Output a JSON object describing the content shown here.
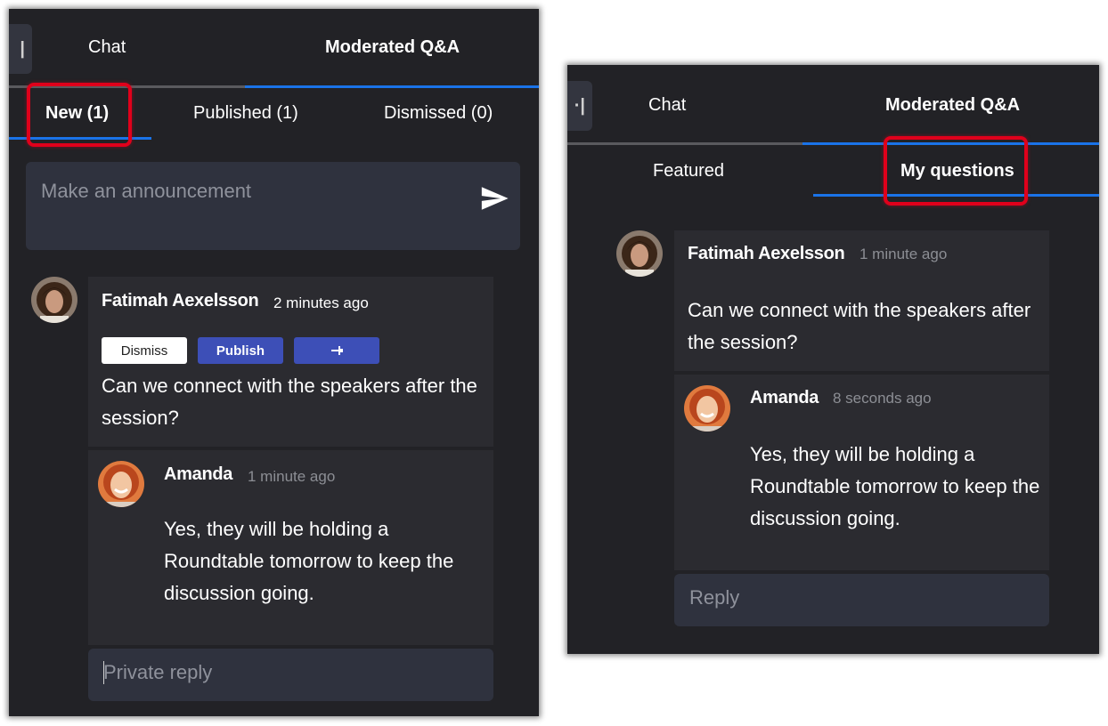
{
  "left": {
    "tabs": {
      "chat": "Chat",
      "qa": "Moderated Q&A"
    },
    "subtabs": {
      "new": "New (1)",
      "published": "Published (1)",
      "dismissed": "Dismissed (0)"
    },
    "announcement": {
      "placeholder": "Make an announcement"
    },
    "question": {
      "author": "Fatimah Aexelsson",
      "time": "2 minutes ago",
      "buttons": {
        "dismiss": "Dismiss",
        "publish": "Publish"
      },
      "text": "Can we connect with the speakers after the session?"
    },
    "reply": {
      "author": "Amanda",
      "time": "1 minute ago",
      "text": "Yes, they will be holding a Roundtable tomorrow to keep the discussion going."
    },
    "private_reply": {
      "placeholder": "Private reply"
    }
  },
  "right": {
    "tabs": {
      "chat": "Chat",
      "qa": "Moderated Q&A"
    },
    "subtabs": {
      "featured": "Featured",
      "my_questions": "My questions"
    },
    "question": {
      "author": "Fatimah Aexelsson",
      "time": "1 minute ago",
      "text": "Can we connect with the speakers after the session?"
    },
    "reply": {
      "author": "Amanda",
      "time": "8 seconds ago",
      "text": "Yes, they will be holding a Roundtable tomorrow to keep the discussion going."
    },
    "reply_box": {
      "placeholder": "Reply"
    }
  },
  "colors": {
    "panel_bg": "#222226",
    "accent_blue": "#1a73e8",
    "highlight_red": "#e0001b",
    "button_blue": "#3d4fb7"
  },
  "icons": [
    "collapse-toggle-icon",
    "send-icon",
    "pin-icon",
    "avatar-fatimah",
    "avatar-amanda"
  ]
}
